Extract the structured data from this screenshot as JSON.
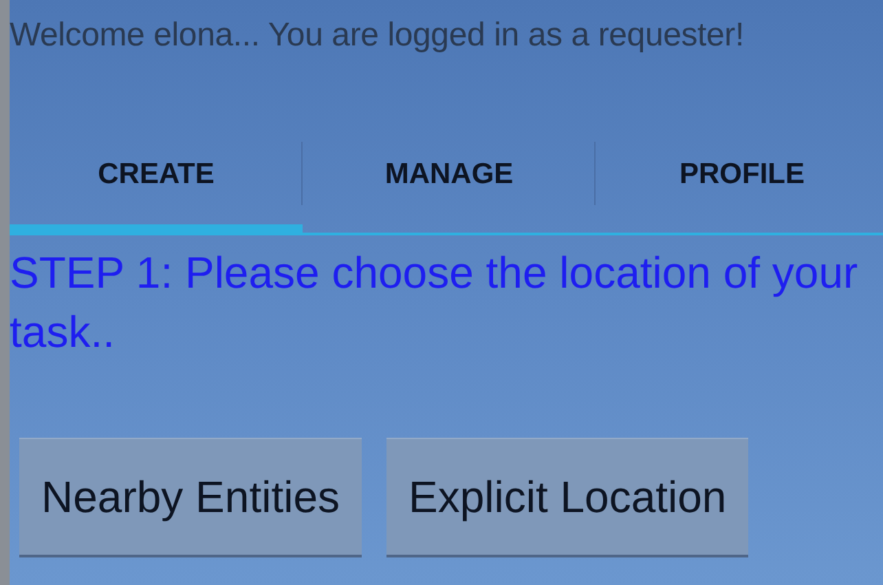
{
  "header": {
    "welcome": "Welcome elona... You are logged in as a requester!"
  },
  "tabs": [
    {
      "label": "CREATE",
      "selected": true
    },
    {
      "label": "MANAGE",
      "selected": false
    },
    {
      "label": "PROFILE",
      "selected": false
    }
  ],
  "step": {
    "text": "STEP 1: Please choose the location of your task.."
  },
  "buttons": [
    "Nearby Entities",
    "Explicit Location"
  ]
}
